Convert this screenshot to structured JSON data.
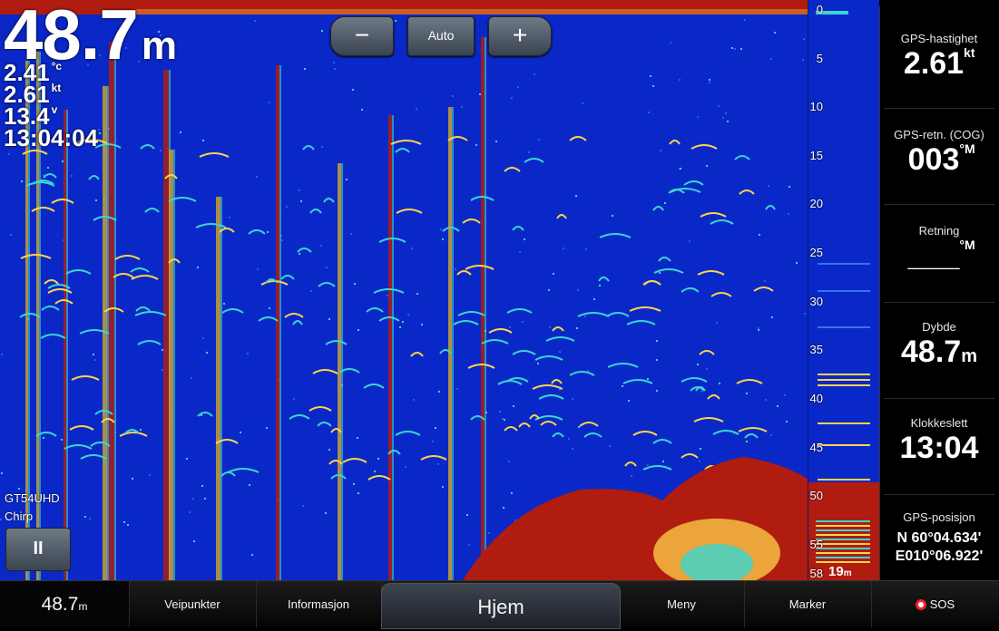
{
  "overlay": {
    "depth_value": "48.7",
    "depth_unit": "m",
    "temp_value": "2.41",
    "temp_unit": "°c",
    "speed_value": "2.61",
    "speed_unit": "kt",
    "voltage_value": "13.4",
    "voltage_unit": "v",
    "time_value": "13:04:04"
  },
  "zoom": {
    "minus_label": "−",
    "auto_label": "Auto",
    "plus_label": "+"
  },
  "transducer": {
    "model": "GT54UHD",
    "mode": "Chirp",
    "pause_label": "II"
  },
  "depth_scale": {
    "ticks": [
      "0",
      "5",
      "10",
      "15",
      "20",
      "25",
      "30",
      "35",
      "40",
      "45",
      "50",
      "55",
      "58"
    ],
    "flasher_depth": "19",
    "flasher_unit": "m"
  },
  "datapanel": {
    "gps_speed_label": "GPS-hastighet",
    "gps_speed_value": "2.61",
    "gps_speed_unit": "kt",
    "cog_label": "GPS-retn. (COG)",
    "cog_value": "003",
    "cog_unit": "°M",
    "heading_label": "Retning",
    "heading_value": "___",
    "heading_unit": "°M",
    "depth_label": "Dybde",
    "depth_value": "48.7",
    "depth_unit": "m",
    "clock_label": "Klokkeslett",
    "clock_value": "13:04",
    "position_label": "GPS-posisjon",
    "position_lat": "N  60°04.634'",
    "position_lon": "E010°06.922'"
  },
  "navbar": {
    "depth_value": "48.7",
    "depth_unit": "m",
    "waypoints": "Veipunkter",
    "info": "Informasjon",
    "home": "Hjem",
    "menu": "Meny",
    "mark": "Marker",
    "sos": "SOS"
  },
  "colors": {
    "water": "#0a28c8",
    "bottom": "#b01c10",
    "echo_strong": "#ffd34a",
    "echo_weak": "#3ad6d0",
    "panel_bg": "#000000"
  }
}
